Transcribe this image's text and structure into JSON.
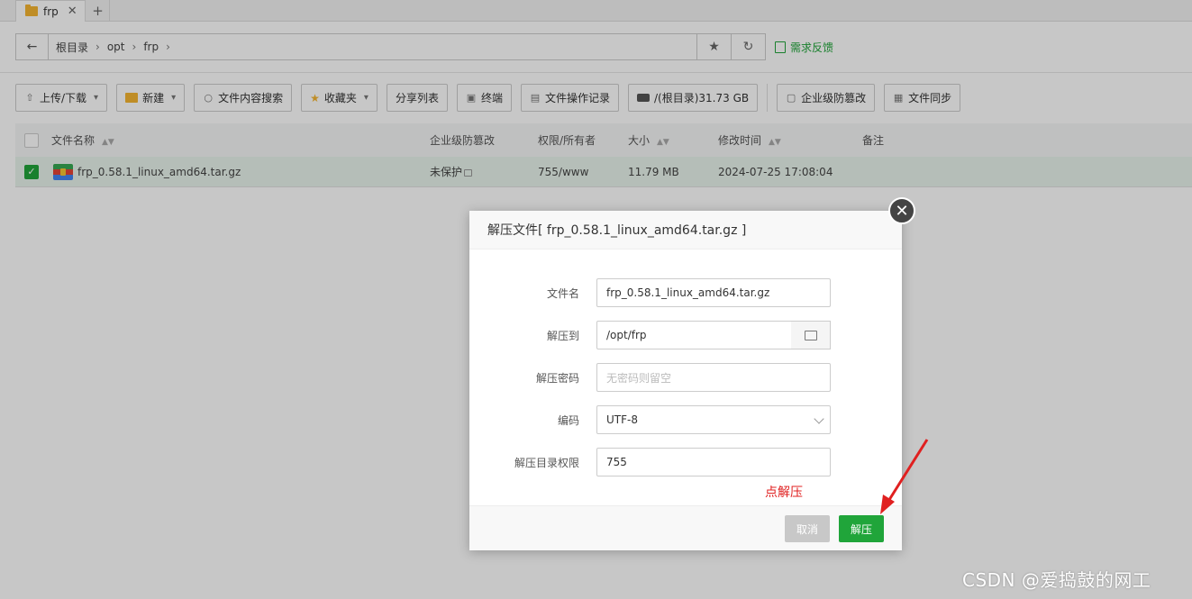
{
  "tabs": [
    {
      "label": "frp",
      "close": "✕"
    }
  ],
  "tab_add": "+",
  "address": {
    "back": "←",
    "crumbs": [
      "根目录",
      "opt",
      "frp"
    ],
    "separator": "›",
    "feedback": "需求反馈"
  },
  "toolbar": {
    "upload": "上传/下载",
    "new": "新建",
    "search_content": "文件内容搜索",
    "favorites": "收藏夹",
    "share_list": "分享列表",
    "terminal": "终端",
    "op_log": "文件操作记录",
    "disk": "/(根目录)31.73 GB",
    "tamper": "企业级防篡改",
    "sync": "文件同步"
  },
  "table": {
    "headers": {
      "name": "文件名称",
      "tamper": "企业级防篡改",
      "perm": "权限/所有者",
      "size": "大小",
      "mtime": "修改时间",
      "note": "备注"
    },
    "rows": [
      {
        "name": "frp_0.58.1_linux_amd64.tar.gz",
        "tamper": "未保护",
        "perm": "755/www",
        "size": "11.79 MB",
        "mtime": "2024-07-25 17:08:04",
        "note": ""
      }
    ]
  },
  "modal": {
    "title": "解压文件[ frp_0.58.1_linux_amd64.tar.gz ]",
    "close": "✕",
    "fields": {
      "filename_label": "文件名",
      "filename_value": "frp_0.58.1_linux_amd64.tar.gz",
      "dest_label": "解压到",
      "dest_value": "/opt/frp",
      "password_label": "解压密码",
      "password_placeholder": "无密码则留空",
      "encoding_label": "编码",
      "encoding_value": "UTF-8",
      "perm_label": "解压目录权限",
      "perm_value": "755"
    },
    "hint": "点解压",
    "cancel": "取消",
    "confirm": "解压"
  },
  "watermark": "CSDN @爱捣鼓的网工",
  "colors": {
    "accent": "#20a53a",
    "annotation": "#e02020"
  }
}
